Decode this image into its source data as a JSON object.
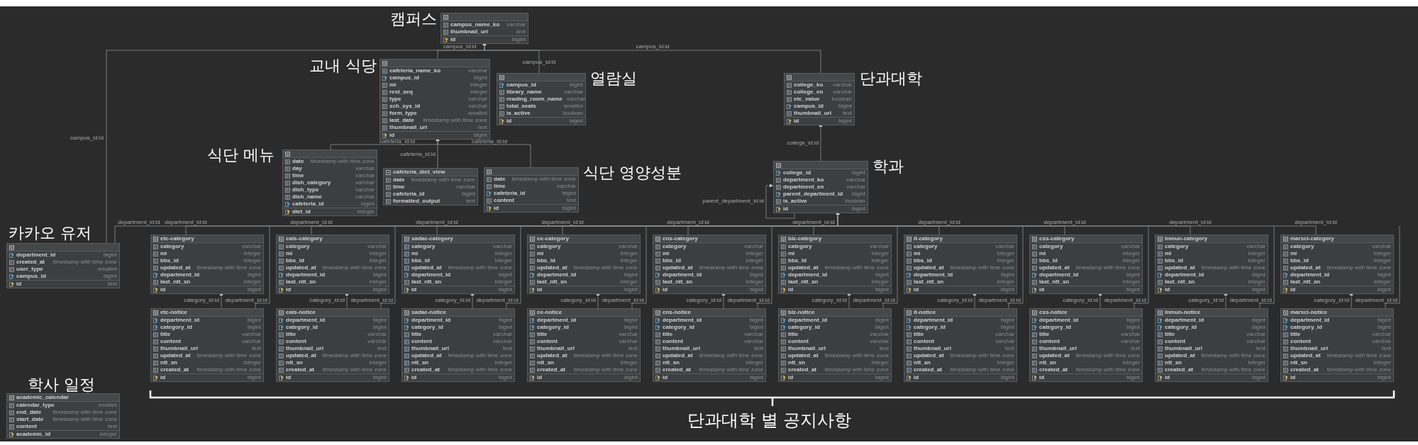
{
  "canvas": {
    "tables": [
      {
        "kind": "table",
        "columns": [
          {
            "name": "campus_name_ko",
            "type": "varchar",
            "kind": "column"
          },
          {
            "name": "thumbnail_url",
            "type": "text",
            "kind": "column"
          },
          {
            "name": "id",
            "type": "bigint",
            "kind": "primary"
          }
        ]
      },
      {
        "kind": "table",
        "columns": [
          {
            "name": "cafeteria_name_ko",
            "type": "varchar",
            "kind": "column"
          },
          {
            "name": "campus_id",
            "type": "bigint",
            "kind": "foreign"
          },
          {
            "name": "mi",
            "type": "integer",
            "kind": "column"
          },
          {
            "name": "rest_seq",
            "type": "integer",
            "kind": "column"
          },
          {
            "name": "type",
            "type": "varchar",
            "kind": "column"
          },
          {
            "name": "sch_sys_id",
            "type": "varchar",
            "kind": "column"
          },
          {
            "name": "form_type",
            "type": "smallint",
            "kind": "column"
          },
          {
            "name": "last_date",
            "type": "timestamp with time zone",
            "kind": "column"
          },
          {
            "name": "thumbnail_url",
            "type": "text",
            "kind": "column"
          },
          {
            "name": "id",
            "type": "bigint",
            "kind": "primary"
          }
        ]
      },
      {
        "kind": "table",
        "columns": [
          {
            "name": "campus_id",
            "type": "bigint",
            "kind": "foreign"
          },
          {
            "name": "library_name",
            "type": "varchar",
            "kind": "column"
          },
          {
            "name": "reading_room_name",
            "type": "varchar",
            "kind": "column"
          },
          {
            "name": "total_seats",
            "type": "smallint",
            "kind": "column"
          },
          {
            "name": "is_active",
            "type": "boolean",
            "kind": "column"
          },
          {
            "name": "id",
            "type": "bigint",
            "kind": "primary"
          }
        ]
      },
      {
        "kind": "table",
        "columns": [
          {
            "name": "college_ko",
            "type": "varchar",
            "kind": "column"
          },
          {
            "name": "college_en",
            "type": "varchar",
            "kind": "column"
          },
          {
            "name": "etc_value",
            "type": "boolean",
            "kind": "column"
          },
          {
            "name": "campus_id",
            "type": "bigint",
            "kind": "foreign"
          },
          {
            "name": "thumbnail_url",
            "type": "text",
            "kind": "column"
          },
          {
            "name": "id",
            "type": "bigint",
            "kind": "primary"
          }
        ]
      },
      {
        "kind": "table",
        "columns": [
          {
            "name": "date",
            "type": "timestamp with time zone",
            "kind": "column"
          },
          {
            "name": "day",
            "type": "varchar",
            "kind": "column"
          },
          {
            "name": "time",
            "type": "varchar",
            "kind": "column"
          },
          {
            "name": "dish_category",
            "type": "varchar",
            "kind": "column"
          },
          {
            "name": "dish_type",
            "type": "varchar",
            "kind": "column"
          },
          {
            "name": "dish_name",
            "type": "varchar",
            "kind": "column"
          },
          {
            "name": "cafeteria_id",
            "type": "bigint",
            "kind": "foreign"
          },
          {
            "name": "diet_id",
            "type": "integer",
            "kind": "primary"
          }
        ]
      },
      {
        "kind": "view",
        "title": "cafeteria_diet_view",
        "columns": [
          {
            "name": "date",
            "type": "timestamp with time zone",
            "kind": "column"
          },
          {
            "name": "time",
            "type": "varchar",
            "kind": "column"
          },
          {
            "name": "cafeteria_id",
            "type": "bigint",
            "kind": "column"
          },
          {
            "name": "formatted_output",
            "type": "text",
            "kind": "column"
          }
        ]
      },
      {
        "kind": "table",
        "columns": [
          {
            "name": "date",
            "type": "timestamp with time zone",
            "kind": "column"
          },
          {
            "name": "time",
            "type": "varchar",
            "kind": "column"
          },
          {
            "name": "cafeteria_id",
            "type": "bigint",
            "kind": "foreign"
          },
          {
            "name": "content",
            "type": "text",
            "kind": "column"
          },
          {
            "name": "id",
            "type": "bigint",
            "kind": "primary"
          }
        ]
      },
      {
        "kind": "table",
        "columns": [
          {
            "name": "college_id",
            "type": "bigint",
            "kind": "foreign"
          },
          {
            "name": "department_ko",
            "type": "varchar",
            "kind": "column"
          },
          {
            "name": "department_en",
            "type": "varchar",
            "kind": "column"
          },
          {
            "name": "parent_department_id",
            "type": "bigint",
            "kind": "foreign"
          },
          {
            "name": "is_active",
            "type": "boolean",
            "kind": "column"
          },
          {
            "name": "id",
            "type": "bigint",
            "kind": "primary"
          }
        ]
      },
      {
        "kind": "table",
        "columns": [
          {
            "name": "department_id",
            "type": "bigint",
            "kind": "foreign"
          },
          {
            "name": "created_at",
            "type": "timestamp with time zone",
            "kind": "column"
          },
          {
            "name": "user_type",
            "type": "smallint",
            "kind": "column"
          },
          {
            "name": "campus_id",
            "type": "bigint",
            "kind": "foreign"
          },
          {
            "name": "id",
            "type": "text",
            "kind": "primary"
          }
        ]
      },
      {
        "kind": "table",
        "title": "academic_calendar",
        "columns": [
          {
            "name": "calendar_type",
            "type": "smallint",
            "kind": "column"
          },
          {
            "name": "end_date",
            "type": "timestamp with time zone",
            "kind": "column"
          },
          {
            "name": "start_date",
            "type": "timestamp with time zone",
            "kind": "column"
          },
          {
            "name": "content",
            "type": "text",
            "kind": "column"
          },
          {
            "name": "academic_id",
            "type": "integer",
            "kind": "primary"
          }
        ]
      },
      {
        "kind": "table",
        "title": "etc-category",
        "columns": [
          {
            "name": "category",
            "type": "varchar",
            "kind": "column"
          },
          {
            "name": "mi",
            "type": "integer",
            "kind": "column"
          },
          {
            "name": "bbs_id",
            "type": "integer",
            "kind": "column"
          },
          {
            "name": "updated_at",
            "type": "timestamp with time zone",
            "kind": "column"
          },
          {
            "name": "department_id",
            "type": "bigint",
            "kind": "foreign"
          },
          {
            "name": "last_ntt_sn",
            "type": "integer",
            "kind": "column"
          },
          {
            "name": "id",
            "type": "bigint",
            "kind": "primary"
          }
        ]
      },
      {
        "kind": "table",
        "title": "cals-category",
        "columns": [
          {
            "name": "category",
            "type": "varchar",
            "kind": "column"
          },
          {
            "name": "mi",
            "type": "integer",
            "kind": "column"
          },
          {
            "name": "bbs_id",
            "type": "integer",
            "kind": "column"
          },
          {
            "name": "updated_at",
            "type": "timestamp with time zone",
            "kind": "column"
          },
          {
            "name": "department_id",
            "type": "bigint",
            "kind": "foreign"
          },
          {
            "name": "last_ntt_sn",
            "type": "integer",
            "kind": "column"
          },
          {
            "name": "id",
            "type": "bigint",
            "kind": "primary"
          }
        ]
      },
      {
        "kind": "table",
        "title": "sadae-category",
        "columns": [
          {
            "name": "category",
            "type": "varchar",
            "kind": "column"
          },
          {
            "name": "mi",
            "type": "integer",
            "kind": "column"
          },
          {
            "name": "bbs_id",
            "type": "integer",
            "kind": "column"
          },
          {
            "name": "updated_at",
            "type": "timestamp with time zone",
            "kind": "column"
          },
          {
            "name": "department_id",
            "type": "bigint",
            "kind": "foreign"
          },
          {
            "name": "last_ntt_sn",
            "type": "integer",
            "kind": "column"
          },
          {
            "name": "id",
            "type": "bigint",
            "kind": "primary"
          }
        ]
      },
      {
        "kind": "table",
        "title": "ce-category",
        "columns": [
          {
            "name": "category",
            "type": "varchar",
            "kind": "column"
          },
          {
            "name": "mi",
            "type": "integer",
            "kind": "column"
          },
          {
            "name": "bbs_id",
            "type": "integer",
            "kind": "column"
          },
          {
            "name": "updated_at",
            "type": "timestamp with time zone",
            "kind": "column"
          },
          {
            "name": "department_id",
            "type": "bigint",
            "kind": "foreign"
          },
          {
            "name": "last_ntt_sn",
            "type": "integer",
            "kind": "column"
          },
          {
            "name": "id",
            "type": "bigint",
            "kind": "primary"
          }
        ]
      },
      {
        "kind": "table",
        "title": "cns-category",
        "columns": [
          {
            "name": "category",
            "type": "varchar",
            "kind": "column"
          },
          {
            "name": "mi",
            "type": "integer",
            "kind": "column"
          },
          {
            "name": "bbs_id",
            "type": "integer",
            "kind": "column"
          },
          {
            "name": "updated_at",
            "type": "timestamp with time zone",
            "kind": "column"
          },
          {
            "name": "department_id",
            "type": "bigint",
            "kind": "foreign"
          },
          {
            "name": "last_ntt_sn",
            "type": "integer",
            "kind": "column"
          },
          {
            "name": "id",
            "type": "bigint",
            "kind": "primary"
          }
        ]
      },
      {
        "kind": "table",
        "title": "biz-category",
        "columns": [
          {
            "name": "category",
            "type": "varchar",
            "kind": "column"
          },
          {
            "name": "mi",
            "type": "integer",
            "kind": "column"
          },
          {
            "name": "bbs_id",
            "type": "integer",
            "kind": "column"
          },
          {
            "name": "updated_at",
            "type": "timestamp with time zone",
            "kind": "column"
          },
          {
            "name": "department_id",
            "type": "bigint",
            "kind": "foreign"
          },
          {
            "name": "last_ntt_sn",
            "type": "integer",
            "kind": "column"
          },
          {
            "name": "id",
            "type": "bigint",
            "kind": "primary"
          }
        ]
      },
      {
        "kind": "table",
        "title": "it-category",
        "columns": [
          {
            "name": "category",
            "type": "varchar",
            "kind": "column"
          },
          {
            "name": "mi",
            "type": "integer",
            "kind": "column"
          },
          {
            "name": "bbs_id",
            "type": "integer",
            "kind": "column"
          },
          {
            "name": "updated_at",
            "type": "timestamp with time zone",
            "kind": "column"
          },
          {
            "name": "department_id",
            "type": "bigint",
            "kind": "foreign"
          },
          {
            "name": "last_ntt_sn",
            "type": "integer",
            "kind": "column"
          },
          {
            "name": "id",
            "type": "bigint",
            "kind": "primary"
          }
        ]
      },
      {
        "kind": "table",
        "title": "css-category",
        "columns": [
          {
            "name": "category",
            "type": "varchar",
            "kind": "column"
          },
          {
            "name": "mi",
            "type": "integer",
            "kind": "column"
          },
          {
            "name": "bbs_id",
            "type": "integer",
            "kind": "column"
          },
          {
            "name": "updated_at",
            "type": "timestamp with time zone",
            "kind": "column"
          },
          {
            "name": "department_id",
            "type": "bigint",
            "kind": "foreign"
          },
          {
            "name": "last_ntt_sn",
            "type": "integer",
            "kind": "column"
          },
          {
            "name": "id",
            "type": "bigint",
            "kind": "primary"
          }
        ]
      },
      {
        "kind": "table",
        "title": "inmun-category",
        "columns": [
          {
            "name": "category",
            "type": "varchar",
            "kind": "column"
          },
          {
            "name": "mi",
            "type": "integer",
            "kind": "column"
          },
          {
            "name": "bbs_id",
            "type": "integer",
            "kind": "column"
          },
          {
            "name": "updated_at",
            "type": "timestamp with time zone",
            "kind": "column"
          },
          {
            "name": "department_id",
            "type": "bigint",
            "kind": "foreign"
          },
          {
            "name": "last_ntt_sn",
            "type": "integer",
            "kind": "column"
          },
          {
            "name": "id",
            "type": "bigint",
            "kind": "primary"
          }
        ]
      },
      {
        "kind": "table",
        "title": "marsci-category",
        "columns": [
          {
            "name": "category",
            "type": "varchar",
            "kind": "column"
          },
          {
            "name": "mi",
            "type": "integer",
            "kind": "column"
          },
          {
            "name": "bbs_id",
            "type": "integer",
            "kind": "column"
          },
          {
            "name": "updated_at",
            "type": "timestamp with time zone",
            "kind": "column"
          },
          {
            "name": "department_id",
            "type": "bigint",
            "kind": "foreign"
          },
          {
            "name": "last_ntt_sn",
            "type": "integer",
            "kind": "column"
          },
          {
            "name": "id",
            "type": "bigint",
            "kind": "primary"
          }
        ]
      },
      {
        "kind": "table",
        "title": "etc-notice",
        "columns": [
          {
            "name": "department_id",
            "type": "bigint",
            "kind": "foreign"
          },
          {
            "name": "category_id",
            "type": "bigint",
            "kind": "foreign"
          },
          {
            "name": "title",
            "type": "varchar",
            "kind": "column"
          },
          {
            "name": "content",
            "type": "varchar",
            "kind": "column"
          },
          {
            "name": "thumbnail_url",
            "type": "text",
            "kind": "column"
          },
          {
            "name": "updated_at",
            "type": "timestamp with time zone",
            "kind": "column"
          },
          {
            "name": "ntt_sn",
            "type": "integer",
            "kind": "column"
          },
          {
            "name": "created_at",
            "type": "timestamp with time zone",
            "kind": "column"
          },
          {
            "name": "id",
            "type": "bigint",
            "kind": "primary"
          }
        ]
      },
      {
        "kind": "table",
        "title": "cals-notice",
        "columns": [
          {
            "name": "department_id",
            "type": "bigint",
            "kind": "foreign"
          },
          {
            "name": "category_id",
            "type": "bigint",
            "kind": "foreign"
          },
          {
            "name": "title",
            "type": "varchar",
            "kind": "column"
          },
          {
            "name": "content",
            "type": "varchar",
            "kind": "column"
          },
          {
            "name": "thumbnail_url",
            "type": "text",
            "kind": "column"
          },
          {
            "name": "updated_at",
            "type": "timestamp with time zone",
            "kind": "column"
          },
          {
            "name": "ntt_sn",
            "type": "integer",
            "kind": "column"
          },
          {
            "name": "created_at",
            "type": "timestamp with time zone",
            "kind": "column"
          },
          {
            "name": "id",
            "type": "bigint",
            "kind": "primary"
          }
        ]
      },
      {
        "kind": "table",
        "title": "sadae-notice",
        "columns": [
          {
            "name": "department_id",
            "type": "bigint",
            "kind": "foreign"
          },
          {
            "name": "category_id",
            "type": "bigint",
            "kind": "foreign"
          },
          {
            "name": "title",
            "type": "varchar",
            "kind": "column"
          },
          {
            "name": "content",
            "type": "varchar",
            "kind": "column"
          },
          {
            "name": "thumbnail_url",
            "type": "text",
            "kind": "column"
          },
          {
            "name": "updated_at",
            "type": "timestamp with time zone",
            "kind": "column"
          },
          {
            "name": "ntt_sn",
            "type": "integer",
            "kind": "column"
          },
          {
            "name": "created_at",
            "type": "timestamp with time zone",
            "kind": "column"
          },
          {
            "name": "id",
            "type": "bigint",
            "kind": "primary"
          }
        ]
      },
      {
        "kind": "table",
        "title": "ce-notice",
        "columns": [
          {
            "name": "department_id",
            "type": "bigint",
            "kind": "foreign"
          },
          {
            "name": "category_id",
            "type": "bigint",
            "kind": "foreign"
          },
          {
            "name": "title",
            "type": "varchar",
            "kind": "column"
          },
          {
            "name": "content",
            "type": "varchar",
            "kind": "column"
          },
          {
            "name": "thumbnail_url",
            "type": "text",
            "kind": "column"
          },
          {
            "name": "updated_at",
            "type": "timestamp with time zone",
            "kind": "column"
          },
          {
            "name": "ntt_sn",
            "type": "integer",
            "kind": "column"
          },
          {
            "name": "created_at",
            "type": "timestamp with time zone",
            "kind": "column"
          },
          {
            "name": "id",
            "type": "bigint",
            "kind": "primary"
          }
        ]
      },
      {
        "kind": "table",
        "title": "cns-notice",
        "columns": [
          {
            "name": "department_id",
            "type": "bigint",
            "kind": "foreign"
          },
          {
            "name": "category_id",
            "type": "bigint",
            "kind": "foreign"
          },
          {
            "name": "title",
            "type": "varchar",
            "kind": "column"
          },
          {
            "name": "content",
            "type": "varchar",
            "kind": "column"
          },
          {
            "name": "thumbnail_url",
            "type": "text",
            "kind": "column"
          },
          {
            "name": "updated_at",
            "type": "timestamp with time zone",
            "kind": "column"
          },
          {
            "name": "ntt_sn",
            "type": "integer",
            "kind": "column"
          },
          {
            "name": "created_at",
            "type": "timestamp with time zone",
            "kind": "column"
          },
          {
            "name": "id",
            "type": "bigint",
            "kind": "primary"
          }
        ]
      },
      {
        "kind": "table",
        "title": "biz-notice",
        "columns": [
          {
            "name": "department_id",
            "type": "bigint",
            "kind": "foreign"
          },
          {
            "name": "category_id",
            "type": "bigint",
            "kind": "foreign"
          },
          {
            "name": "title",
            "type": "varchar",
            "kind": "column"
          },
          {
            "name": "content",
            "type": "varchar",
            "kind": "column"
          },
          {
            "name": "thumbnail_url",
            "type": "text",
            "kind": "column"
          },
          {
            "name": "updated_at",
            "type": "timestamp with time zone",
            "kind": "column"
          },
          {
            "name": "ntt_sn",
            "type": "integer",
            "kind": "column"
          },
          {
            "name": "created_at",
            "type": "timestamp with time zone",
            "kind": "column"
          },
          {
            "name": "id",
            "type": "bigint",
            "kind": "primary"
          }
        ]
      },
      {
        "kind": "table",
        "title": "it-notice",
        "columns": [
          {
            "name": "department_id",
            "type": "bigint",
            "kind": "foreign"
          },
          {
            "name": "category_id",
            "type": "bigint",
            "kind": "foreign"
          },
          {
            "name": "title",
            "type": "varchar",
            "kind": "column"
          },
          {
            "name": "content",
            "type": "varchar",
            "kind": "column"
          },
          {
            "name": "thumbnail_url",
            "type": "text",
            "kind": "column"
          },
          {
            "name": "updated_at",
            "type": "timestamp with time zone",
            "kind": "column"
          },
          {
            "name": "ntt_sn",
            "type": "integer",
            "kind": "column"
          },
          {
            "name": "created_at",
            "type": "timestamp with time zone",
            "kind": "column"
          },
          {
            "name": "id",
            "type": "bigint",
            "kind": "primary"
          }
        ]
      },
      {
        "kind": "table",
        "title": "css-notice",
        "columns": [
          {
            "name": "department_id",
            "type": "bigint",
            "kind": "foreign"
          },
          {
            "name": "category_id",
            "type": "bigint",
            "kind": "foreign"
          },
          {
            "name": "title",
            "type": "varchar",
            "kind": "column"
          },
          {
            "name": "content",
            "type": "varchar",
            "kind": "column"
          },
          {
            "name": "thumbnail_url",
            "type": "text",
            "kind": "column"
          },
          {
            "name": "updated_at",
            "type": "timestamp with time zone",
            "kind": "column"
          },
          {
            "name": "ntt_sn",
            "type": "integer",
            "kind": "column"
          },
          {
            "name": "created_at",
            "type": "timestamp with time zone",
            "kind": "column"
          },
          {
            "name": "id",
            "type": "bigint",
            "kind": "primary"
          }
        ]
      },
      {
        "kind": "table",
        "title": "inmun-notice",
        "columns": [
          {
            "name": "department_id",
            "type": "bigint",
            "kind": "foreign"
          },
          {
            "name": "category_id",
            "type": "bigint",
            "kind": "foreign"
          },
          {
            "name": "title",
            "type": "varchar",
            "kind": "column"
          },
          {
            "name": "content",
            "type": "varchar",
            "kind": "column"
          },
          {
            "name": "thumbnail_url",
            "type": "text",
            "kind": "column"
          },
          {
            "name": "updated_at",
            "type": "timestamp with time zone",
            "kind": "column"
          },
          {
            "name": "ntt_sn",
            "type": "integer",
            "kind": "column"
          },
          {
            "name": "created_at",
            "type": "timestamp with time zone",
            "kind": "column"
          },
          {
            "name": "id",
            "type": "bigint",
            "kind": "primary"
          }
        ]
      },
      {
        "kind": "table",
        "title": "marsci-notice",
        "columns": [
          {
            "name": "department_id",
            "type": "bigint",
            "kind": "foreign"
          },
          {
            "name": "category_id",
            "type": "bigint",
            "kind": "foreign"
          },
          {
            "name": "title",
            "type": "varchar",
            "kind": "column"
          },
          {
            "name": "content",
            "type": "varchar",
            "kind": "column"
          },
          {
            "name": "thumbnail_url",
            "type": "text",
            "kind": "column"
          },
          {
            "name": "updated_at",
            "type": "timestamp with time zone",
            "kind": "column"
          },
          {
            "name": "ntt_sn",
            "type": "integer",
            "kind": "column"
          },
          {
            "name": "created_at",
            "type": "timestamp with time zone",
            "kind": "column"
          },
          {
            "name": "id",
            "type": "bigint",
            "kind": "primary"
          }
        ]
      }
    ],
    "relations": [
      {
        "label": "campus_id:id"
      },
      {
        "label": "campus_id:id"
      },
      {
        "label": "campus_id:id"
      },
      {
        "label": "campus_id:id"
      },
      {
        "label": "cafeteria_id:id"
      },
      {
        "label": "cafeteria_id:id"
      },
      {
        "label": "cafeteria_id:id"
      },
      {
        "label": "college_id:id"
      },
      {
        "label": "parent_department_id:id"
      },
      {
        "label": "department_id:id"
      },
      {
        "label": "department_id:id"
      },
      {
        "label": "category_id:id"
      },
      {
        "label": "department_id:id"
      },
      {
        "label": "department_id:id"
      },
      {
        "label": "category_id:id"
      },
      {
        "label": "department_id:id"
      },
      {
        "label": "department_id:id"
      },
      {
        "label": "category_id:id"
      },
      {
        "label": "department_id:id"
      },
      {
        "label": "department_id:id"
      },
      {
        "label": "category_id:id"
      },
      {
        "label": "department_id:id"
      },
      {
        "label": "department_id:id"
      },
      {
        "label": "category_id:id"
      },
      {
        "label": "department_id:id"
      },
      {
        "label": "department_id:id"
      },
      {
        "label": "category_id:id"
      },
      {
        "label": "department_id:id"
      },
      {
        "label": "department_id:id"
      },
      {
        "label": "category_id:id"
      },
      {
        "label": "department_id:id"
      },
      {
        "label": "department_id:id"
      },
      {
        "label": "category_id:id"
      },
      {
        "label": "department_id:id"
      },
      {
        "label": "department_id:id"
      },
      {
        "label": "category_id:id"
      },
      {
        "label": "department_id:id"
      },
      {
        "label": "department_id:id"
      },
      {
        "label": "category_id:id"
      },
      {
        "label": "department_id:id"
      }
    ],
    "annotations": [
      {
        "text": "캠퍼스"
      },
      {
        "text": "교내 식당"
      },
      {
        "text": "열람실"
      },
      {
        "text": "단과대학"
      },
      {
        "text": "식단 메뉴"
      },
      {
        "text": "식단 영양성분"
      },
      {
        "text": "학과"
      },
      {
        "text": "카카오 유저"
      },
      {
        "text": "학사 일정"
      }
    ],
    "brace": {
      "label": "단과대학 별 공지사항"
    }
  }
}
